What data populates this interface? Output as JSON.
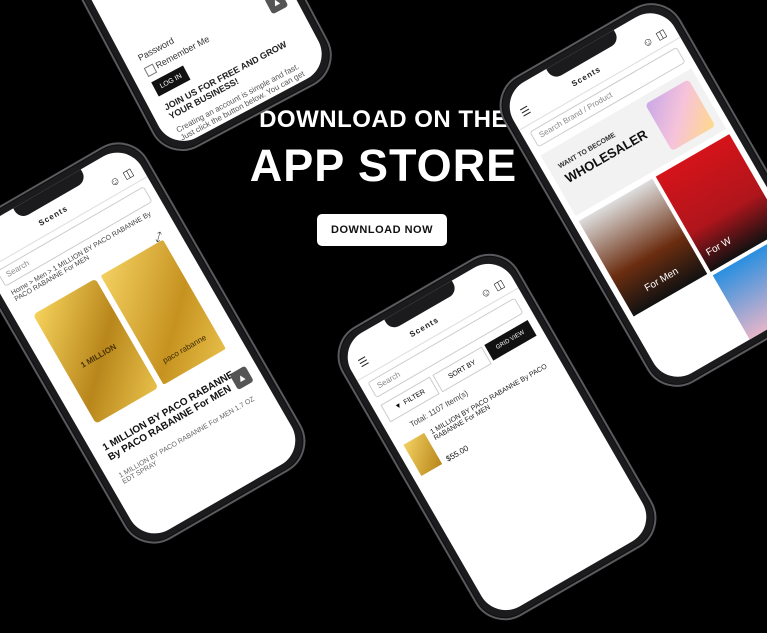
{
  "headline": {
    "line1": "DOWNLOAD ON THE",
    "line2": "APP STORE"
  },
  "cta": {
    "label": "DOWNLOAD NOW"
  },
  "phone_login": {
    "password_label": "Password",
    "remember_label": "Remember Me",
    "login_button": "LOG IN",
    "join_text": "JOIN US FOR FREE AND GROW YOUR BUSINESS!",
    "body_text": "Creating an account is simple and fast. Just click the button below. You can get"
  },
  "phone_product": {
    "logo": "Scents",
    "search_placeholder": "Search",
    "breadcrumb": "Home > Men > 1 MILLION BY PACO RABANNE By PACO RABANNE For MEN",
    "product_name": "1 MILLION BY PACO RABANNE By PACO RABANNE For MEN",
    "brand": "paco rabanne",
    "box_text": "1 MILLION",
    "description": "1 MILLION BY PACO RABANNE For MEN 1.7 OZ EDT SPRAY"
  },
  "phone_home": {
    "logo": "Scents",
    "search_placeholder": "Search Brand / Product",
    "promo_small": "WANT TO BECOME",
    "promo_big": "WHOLESALER",
    "category_label": "For Men",
    "category_label2": "For W"
  },
  "phone_list": {
    "logo": "Scents",
    "search_placeholder": "Search",
    "filter_label": "FILTER",
    "sort_label": "SORT BY",
    "grid_label": "GRID VIEW",
    "total_label": "Total: 1107 Item(s)",
    "item_name": "1 MILLION BY PACO RABANNE By PACO RABANNE For MEN",
    "item_price": "$55.00"
  }
}
